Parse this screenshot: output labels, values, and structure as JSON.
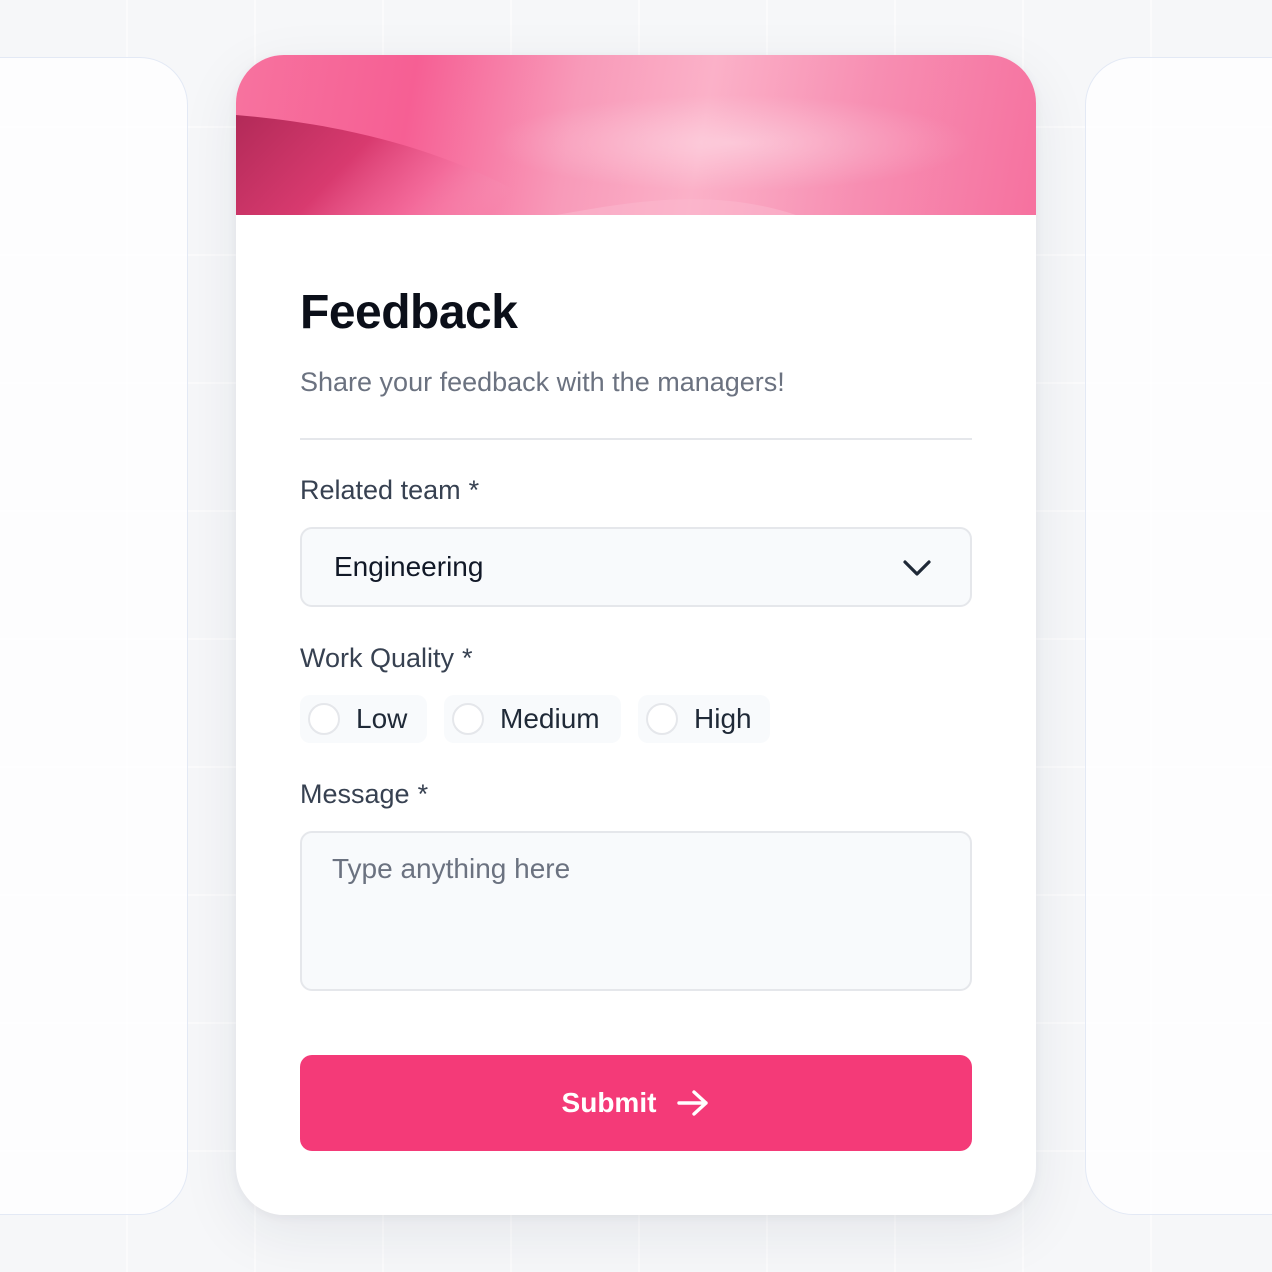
{
  "form": {
    "title": "Feedback",
    "subtitle": "Share your feedback with the managers!",
    "team_field": {
      "label": "Related team",
      "required_mark": "*",
      "selected_value": "Engineering",
      "icon": "chevron-down-icon"
    },
    "quality_field": {
      "label": "Work Quality",
      "required_mark": "*",
      "options": [
        {
          "label": "Low",
          "selected": false
        },
        {
          "label": "Medium",
          "selected": false
        },
        {
          "label": "High",
          "selected": false
        }
      ]
    },
    "message_field": {
      "label": "Message",
      "required_mark": "*",
      "value": "",
      "placeholder": "Type anything here"
    },
    "submit": {
      "label": "Submit",
      "icon": "arrow-right-icon"
    }
  },
  "colors": {
    "accent": "#f43a78",
    "banner_pink": "#f65f94",
    "banner_dark": "#b8285a",
    "title": "#0b0f19",
    "muted_text": "#6b7280",
    "field_bg": "#f8fafc",
    "border": "#e5e7eb"
  }
}
